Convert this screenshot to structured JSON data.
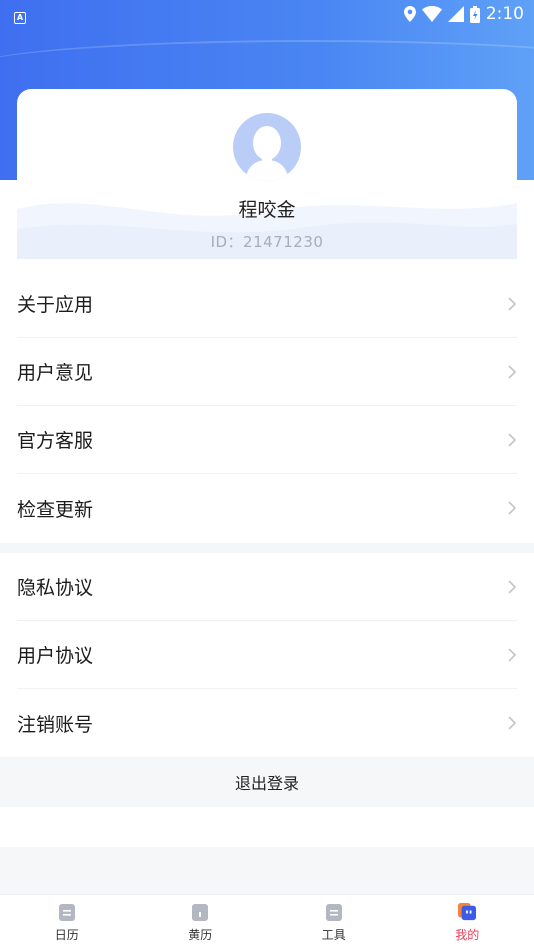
{
  "status_bar": {
    "time": "2:10",
    "badge": "A"
  },
  "profile": {
    "name": "程咬金",
    "id_text": "ID：21471230"
  },
  "menu_group_1": [
    {
      "label": "关于应用"
    },
    {
      "label": "用户意见"
    },
    {
      "label": "官方客服"
    },
    {
      "label": "检查更新"
    }
  ],
  "menu_group_2": [
    {
      "label": "隐私协议"
    },
    {
      "label": "用户协议"
    },
    {
      "label": "注销账号"
    }
  ],
  "logout_label": "退出登录",
  "tabs": [
    {
      "label": "日历",
      "icon": "calendar-icon"
    },
    {
      "label": "黄历",
      "icon": "almanac-icon"
    },
    {
      "label": "工具",
      "icon": "tools-icon"
    },
    {
      "label": "我的",
      "icon": "mine-icon",
      "active": true
    }
  ],
  "colors": {
    "accent": "#ef3d57",
    "header": "#4a86f3",
    "avatar": "#b9cdf6"
  }
}
